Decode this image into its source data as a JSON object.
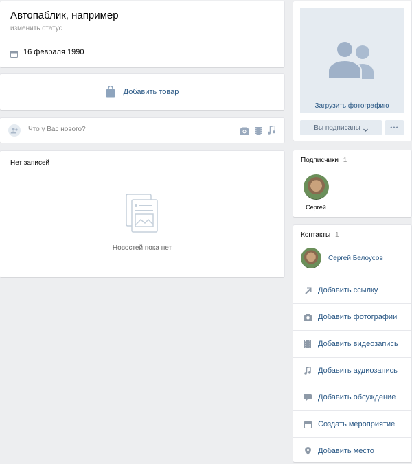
{
  "profile": {
    "name": "Автопаблик, например",
    "status_link": "изменить статус",
    "birthday": "16 февраля 1990"
  },
  "market": {
    "add_product": "Добавить товар"
  },
  "composer": {
    "placeholder": "Что у Вас нового?"
  },
  "wall": {
    "header": "Нет записей",
    "empty_text": "Новостей пока нет"
  },
  "photo_block": {
    "upload_label": "Загрузить фотографию",
    "subscribed_label": "Вы подписаны",
    "more_label": "•••"
  },
  "subscribers": {
    "title": "Подписчики",
    "count": "1",
    "items": [
      {
        "name": "Сергей"
      }
    ]
  },
  "contacts": {
    "title": "Контакты",
    "count": "1",
    "items": [
      {
        "name": "Сергей Белоусов"
      }
    ]
  },
  "actions": [
    {
      "label": "Добавить ссылку",
      "icon": "link-arrow-icon"
    },
    {
      "label": "Добавить фотографии",
      "icon": "camera-icon"
    },
    {
      "label": "Добавить видеозапись",
      "icon": "film-icon"
    },
    {
      "label": "Добавить аудиозапись",
      "icon": "music-note-icon"
    },
    {
      "label": "Добавить обсуждение",
      "icon": "chat-bubble-icon"
    },
    {
      "label": "Создать мероприятие",
      "icon": "calendar-icon"
    },
    {
      "label": "Добавить место",
      "icon": "map-pin-icon"
    }
  ],
  "colors": {
    "link": "#2a5885",
    "icon": "#aab8c9",
    "page_bg": "#edeef0",
    "placeholder_bg": "#e5ebf1"
  }
}
